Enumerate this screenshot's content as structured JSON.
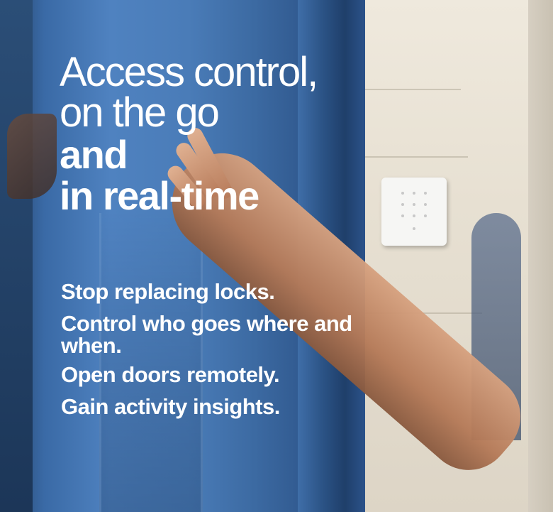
{
  "headline": {
    "light_line_1": "Access control,",
    "light_line_2": "on the go",
    "bold_line_1": "and",
    "bold_line_2": "in real-time"
  },
  "points": [
    "Stop replacing locks.",
    "Control who goes where and when.",
    "Open doors remotely.",
    "Gain activity insights."
  ],
  "colors": {
    "text": "#ffffff",
    "door_blue": "#4f82c0",
    "stone": "#e9e3d6"
  },
  "icons": [
    "keypad-device"
  ]
}
